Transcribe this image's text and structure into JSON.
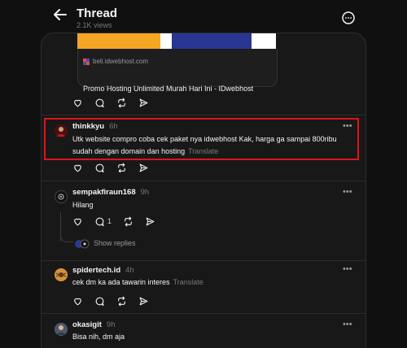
{
  "header": {
    "title": "Thread",
    "views": "2.1K views",
    "back_icon": "arrow-left-icon",
    "more_icon": "more-circle-icon"
  },
  "banner_colors": [
    "#f5a623",
    "#283593"
  ],
  "link_card": {
    "domain": "beli.idwebhost.com",
    "title": "Promo Hosting Unlimited Murah Hari Ini - IDwebhost"
  },
  "posts": [
    {
      "username": "thinkkyu",
      "time": "6h",
      "text_line1": "Utk website compro coba cek paket nya idwebhost Kak, harga ga sampai 800ribu",
      "text_line2": "sudah dengan domain dan hosting",
      "translate": "Translate"
    },
    {
      "username": "sempakfiraun168",
      "time": "9h",
      "text": "Hilang",
      "reply_count": "1",
      "show_replies": "Show replies"
    },
    {
      "username": "spidertech.id",
      "time": "4h",
      "text": "cek dm ka ada tawarin interes",
      "translate": "Translate"
    },
    {
      "username": "okasigit",
      "time": "9h",
      "text": "Bisa nih, dm aja"
    }
  ],
  "more_label": "•••",
  "highlight_color": "#e0131b"
}
